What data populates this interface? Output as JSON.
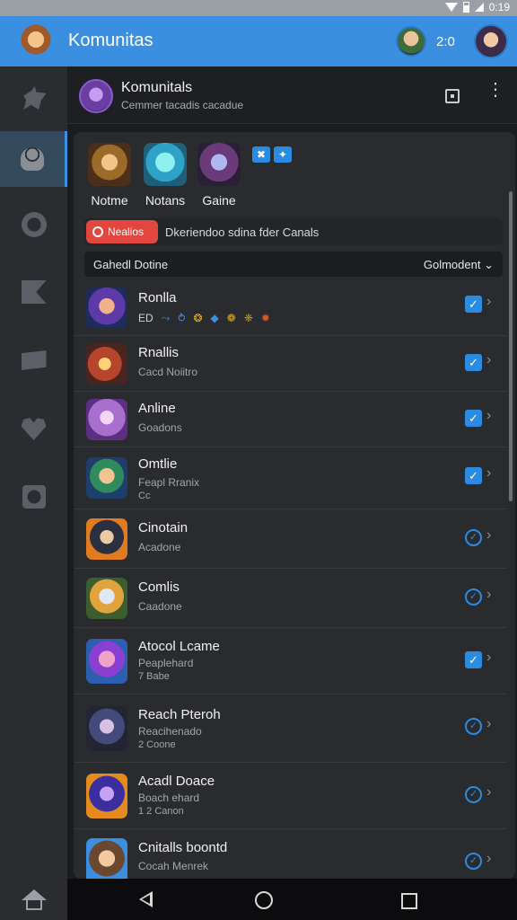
{
  "status_bar": {
    "time": "0:19"
  },
  "app_bar": {
    "title": "Komunitas",
    "count": "2:0"
  },
  "community": {
    "title": "Komunitals",
    "subtitle": "Cemmer tacadis cacadue"
  },
  "featured": [
    {
      "label": "Notme"
    },
    {
      "label": "Notans"
    },
    {
      "label": "Gaine"
    }
  ],
  "tag_icons": [
    "✖",
    "✦"
  ],
  "notice": {
    "badge": "Nealios",
    "text": "Dkeriendoo sdina fder Canals"
  },
  "filter": {
    "label": "Gahedl Dotine",
    "sort": "Golmodent"
  },
  "rows": [
    {
      "title": "Ronlla",
      "sub": "",
      "sub2": ""
    },
    {
      "title": "Rnallis",
      "sub": "Cacd Noiitro",
      "sub2": ""
    },
    {
      "title": "Anline",
      "sub": "Goadons",
      "sub2": ""
    },
    {
      "title": "Omtlie",
      "sub": "Feapl Rranix",
      "sub2": "Cc"
    },
    {
      "title": "Cinotain",
      "sub": "Acadone",
      "sub2": ""
    },
    {
      "title": "Comlis",
      "sub": "Caadone",
      "sub2": ""
    },
    {
      "title": "Atocol Lcame",
      "sub": "Peaplehard",
      "sub2": "7 Babe"
    },
    {
      "title": "Reach Pteroh",
      "sub": "Reacihenado",
      "sub2": "2 Coone"
    },
    {
      "title": "Acadl Doace",
      "sub": "Boach ehard",
      "sub2": "1 2 Canon"
    },
    {
      "title": "Cnitalls boontd",
      "sub": "Cocah Menrek",
      "sub2": ""
    }
  ],
  "row1_mini": [
    "ED",
    "⤳",
    "⥁",
    "❂",
    "◆",
    "❁",
    "❈",
    "✹"
  ],
  "colors": {
    "accent": "#3a8fe0",
    "badge": "#e2463f",
    "background": "#1b1c1f"
  }
}
